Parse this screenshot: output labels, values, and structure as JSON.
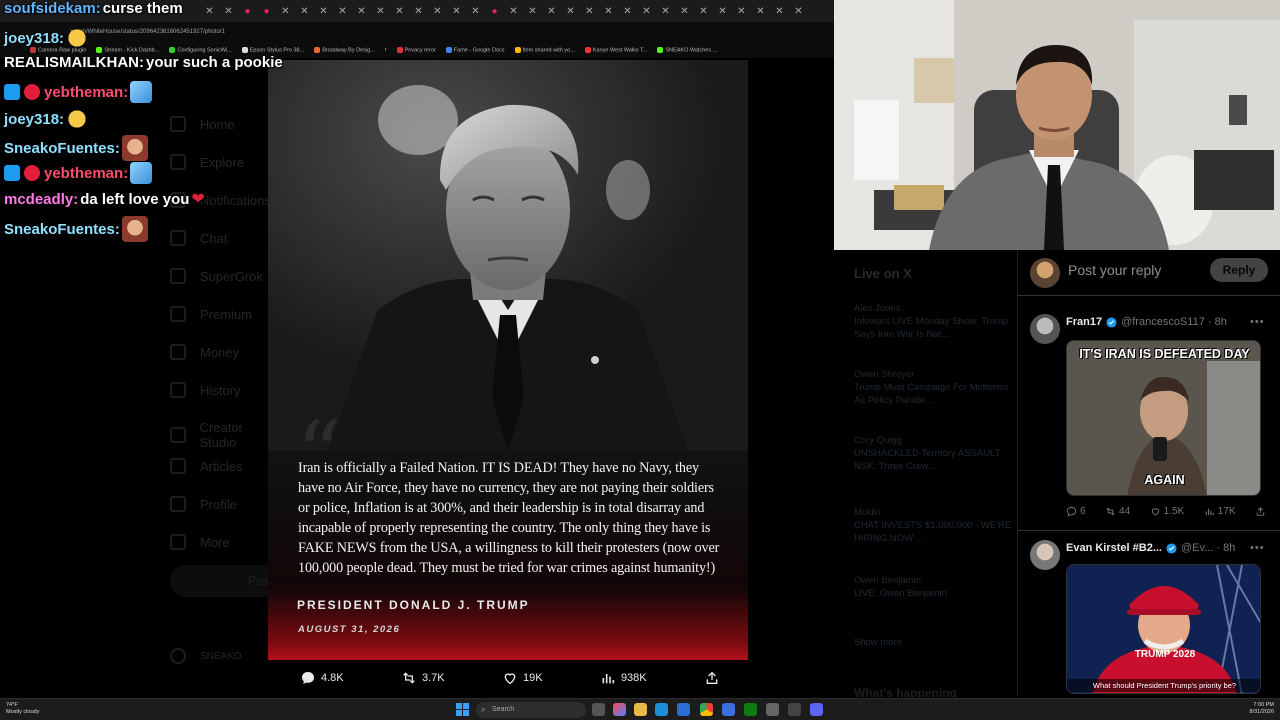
{
  "browser": {
    "url": "x.com/WhiteHouse/status/2096423616062451927/photo/1",
    "bookmarks": [
      "Camera Raw plugin",
      "Stream - Kick Dashb...",
      "Configuring SonicWi...",
      "Epson Stylus Pro 38...",
      "Broadway By Desig...",
      "r",
      "Privacy error",
      "Fame - Google Docs",
      "Item shared with yo...",
      "Kanye West Walks T...",
      "SNEAKO Watches ..."
    ]
  },
  "chat": [
    {
      "user": "soufsidekam:",
      "message": "curse them",
      "color": "#62b6ff"
    },
    {
      "user": "joey318:",
      "message": "",
      "color": "#8fe0ff"
    },
    {
      "user": "REALISMAILKHAN:",
      "message": "your such a pookie",
      "color": "#ffffff"
    },
    {
      "user": "yebtheman:",
      "message": "",
      "color": "#ff4d6d"
    },
    {
      "user": "joey318:",
      "message": "",
      "color": "#8fe0ff"
    },
    {
      "user": "SneakoFuentes:",
      "message": "",
      "color": "#8fe0ff"
    },
    {
      "user": "yebtheman:",
      "message": "",
      "color": "#ff4d6d"
    },
    {
      "user": "mcdeadly:",
      "message": "da left love you",
      "color": "#ff7be6"
    },
    {
      "user": "SneakoFuentes:",
      "message": "",
      "color": "#8fe0ff"
    }
  ],
  "x_sidebar": {
    "items": [
      "Home",
      "Explore",
      "Notifications",
      "Chat",
      "SuperGrok",
      "Premium",
      "Money",
      "History",
      "Creator Studio",
      "Articles",
      "Profile",
      "More"
    ],
    "post_label": "Post",
    "account_label": "SNEAKO"
  },
  "post": {
    "quote": "Iran is officially a Failed Nation. IT IS DEAD! They have no Navy, they have no Air Force, they have no currency, they are not paying their soldiers or police, Inflation is at 300%, and their leadership is in total disarray and incapable of properly representing the country. The only thing they have is FAKE NEWS from the USA, a willingness to kill their protesters (now over 100,000 people dead. They must be tried for war crimes against humanity!)",
    "signature": "PRESIDENT DONALD J. TRUMP",
    "date": "AUGUST 31, 2026",
    "actions": {
      "replies": "4.8K",
      "reposts": "3.7K",
      "likes": "19K",
      "views": "938K"
    }
  },
  "live": {
    "title": "Live on X",
    "items": [
      {
        "who": "Alex Jones",
        "text": "Infowars LIVE Monday Show: Trump Says Iran War Is Nat..."
      },
      {
        "who": "Owen Shroyer",
        "text": "Trump Must Campaign For Midterms As Policy Paralle..."
      },
      {
        "who": "Cory Quigg",
        "text": "UNSHACKLED Territory ASSAULT NSK: Three Crew..."
      },
      {
        "who": "Mckiki",
        "text": "CHAT INVESTS $1,000,000 - WE'RE HIRING NOW ..."
      },
      {
        "who": "Owen Benjamin",
        "text": "LIVE: Owen Benjamin"
      }
    ],
    "show_more": "Show more",
    "whats_happening": "What's happening"
  },
  "reply_panel": {
    "placeholder": "Post your reply",
    "button": "Reply",
    "replies": [
      {
        "name": "Fran17",
        "handle": "@francescoS117 · 8h",
        "media_top": "IT'S IRAN IS DEFEATED DAY",
        "media_bottom": "AGAIN",
        "stats": {
          "replies": "6",
          "reposts": "44",
          "likes": "1.5K",
          "views": "17K"
        }
      },
      {
        "name": "Evan Kirstel #B2...",
        "handle": "@Ev... · 8h",
        "media_caption": "What should President Trump's priority be?",
        "hat_text": "TRUMP 2028"
      }
    ]
  },
  "taskbar": {
    "weather_temp": "74°F",
    "weather_desc": "Mostly cloudy",
    "search_placeholder": "Search",
    "time": "7:00 PM",
    "date": "8/31/2026"
  },
  "colors": {
    "accent": "#1d9bf0",
    "verified": "#1d9bf0",
    "heart": "#e3203a"
  }
}
